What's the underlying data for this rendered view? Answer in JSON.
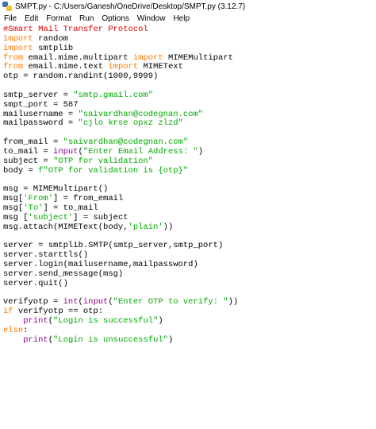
{
  "window": {
    "title": "SMPT.py - C:/Users/Ganesh/OneDrive/Desktop/SMPT.py (3.12.7)"
  },
  "menu": [
    "File",
    "Edit",
    "Format",
    "Run",
    "Options",
    "Window",
    "Help"
  ],
  "colors": {
    "comment": "#dd0000",
    "keyword": "#ff7700",
    "builtin": "#900090",
    "string": "#00aa00",
    "default": "#000000"
  },
  "code": [
    [
      {
        "t": "comment",
        "s": "#Smart Mail Transfer Protocol"
      }
    ],
    [
      {
        "t": "keyword",
        "s": "import"
      },
      {
        "t": "default",
        "s": " random"
      }
    ],
    [
      {
        "t": "keyword",
        "s": "import"
      },
      {
        "t": "default",
        "s": " smtplib"
      }
    ],
    [
      {
        "t": "keyword",
        "s": "from"
      },
      {
        "t": "default",
        "s": " email.mime.multipart "
      },
      {
        "t": "keyword",
        "s": "import"
      },
      {
        "t": "default",
        "s": " MIMEMultipart"
      }
    ],
    [
      {
        "t": "keyword",
        "s": "from"
      },
      {
        "t": "default",
        "s": " email.mime.text "
      },
      {
        "t": "keyword",
        "s": "import"
      },
      {
        "t": "default",
        "s": " MIMEText"
      }
    ],
    [
      {
        "t": "default",
        "s": "otp = random.randint(1000,9999)"
      }
    ],
    [],
    [
      {
        "t": "default",
        "s": "smtp_server = "
      },
      {
        "t": "string",
        "s": "\"smtp.gmail.com\""
      }
    ],
    [
      {
        "t": "default",
        "s": "smpt_port = 587"
      }
    ],
    [
      {
        "t": "default",
        "s": "mailusername = "
      },
      {
        "t": "string",
        "s": "\"saivardhan@codegnan.com\""
      }
    ],
    [
      {
        "t": "default",
        "s": "mailpassword = "
      },
      {
        "t": "string",
        "s": "\"cjlo krse opxz zlzd\""
      }
    ],
    [],
    [
      {
        "t": "default",
        "s": "from_mail = "
      },
      {
        "t": "string",
        "s": "\"saivardhan@codegnan.com\""
      }
    ],
    [
      {
        "t": "default",
        "s": "to_mail = "
      },
      {
        "t": "builtin",
        "s": "input"
      },
      {
        "t": "default",
        "s": "("
      },
      {
        "t": "string",
        "s": "\"Enter Email Address: \""
      },
      {
        "t": "default",
        "s": ")"
      }
    ],
    [
      {
        "t": "default",
        "s": "subject = "
      },
      {
        "t": "string",
        "s": "\"OTP for validation\""
      }
    ],
    [
      {
        "t": "default",
        "s": "body = "
      },
      {
        "t": "string",
        "s": "f\"OTP for validation is {otp}\""
      }
    ],
    [],
    [
      {
        "t": "default",
        "s": "msg = MIMEMultipart()"
      }
    ],
    [
      {
        "t": "default",
        "s": "msg["
      },
      {
        "t": "string",
        "s": "'From'"
      },
      {
        "t": "default",
        "s": "] = from_email"
      }
    ],
    [
      {
        "t": "default",
        "s": "msg["
      },
      {
        "t": "string",
        "s": "'To'"
      },
      {
        "t": "default",
        "s": "] = to_mail"
      }
    ],
    [
      {
        "t": "default",
        "s": "msg ["
      },
      {
        "t": "string",
        "s": "'subject'"
      },
      {
        "t": "default",
        "s": "] = subject"
      }
    ],
    [
      {
        "t": "default",
        "s": "msg.attach(MIMEText(body,"
      },
      {
        "t": "string",
        "s": "'plain'"
      },
      {
        "t": "default",
        "s": "))"
      }
    ],
    [],
    [
      {
        "t": "default",
        "s": "server = smtplib.SMTP(smtp_server,smtp_port)"
      }
    ],
    [
      {
        "t": "default",
        "s": "server.starttls()"
      }
    ],
    [
      {
        "t": "default",
        "s": "server.login(mailusername,mailpassword)"
      }
    ],
    [
      {
        "t": "default",
        "s": "server.send_message(msg)"
      }
    ],
    [
      {
        "t": "default",
        "s": "server.quit()"
      }
    ],
    [],
    [
      {
        "t": "default",
        "s": "verifyotp = "
      },
      {
        "t": "builtin",
        "s": "int"
      },
      {
        "t": "default",
        "s": "("
      },
      {
        "t": "builtin",
        "s": "input"
      },
      {
        "t": "default",
        "s": "("
      },
      {
        "t": "string",
        "s": "\"Enter OTP to verify: \""
      },
      {
        "t": "default",
        "s": "))"
      }
    ],
    [
      {
        "t": "keyword",
        "s": "if"
      },
      {
        "t": "default",
        "s": " verifyotp == otp:"
      }
    ],
    [
      {
        "t": "default",
        "s": "    "
      },
      {
        "t": "builtin",
        "s": "print"
      },
      {
        "t": "default",
        "s": "("
      },
      {
        "t": "string",
        "s": "\"Login is successful\""
      },
      {
        "t": "default",
        "s": ")"
      }
    ],
    [
      {
        "t": "keyword",
        "s": "else"
      },
      {
        "t": "default",
        "s": ":"
      }
    ],
    [
      {
        "t": "default",
        "s": "    "
      },
      {
        "t": "builtin",
        "s": "print"
      },
      {
        "t": "default",
        "s": "("
      },
      {
        "t": "string",
        "s": "\"Login is unsuccessful\""
      },
      {
        "t": "default",
        "s": ")"
      }
    ]
  ]
}
